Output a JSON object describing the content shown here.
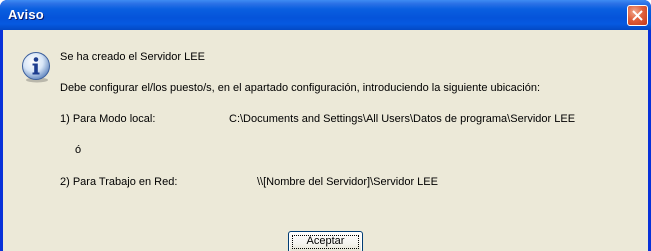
{
  "window": {
    "title": "Aviso"
  },
  "dialog": {
    "icon": "information-icon",
    "line1": "Se ha creado el Servidor LEE",
    "line2": "Debe configurar el/los puesto/s, en el apartado configuración, introduciendo la siguiente ubicación:",
    "option1_label": "1) Para Modo local:",
    "option1_path": "C:\\Documents and Settings\\All Users\\Datos de programa\\Servidor LEE",
    "or_text": "ó",
    "option2_label": "2) Para Trabajo en Red:",
    "option2_path": "\\\\[Nombre del Servidor]\\Servidor LEE"
  },
  "buttons": {
    "accept_label": "Aceptar"
  },
  "colors": {
    "titlebar": "#0553da",
    "client_bg": "#ece9d8",
    "close_button": "#e0603c"
  }
}
